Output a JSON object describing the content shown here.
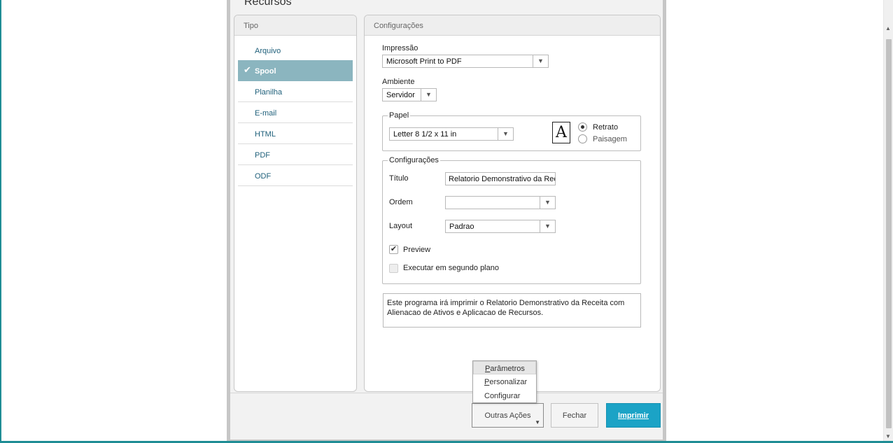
{
  "dialog": {
    "title": "Recursos"
  },
  "tipo": {
    "header": "Tipo",
    "items": [
      {
        "label": "Arquivo",
        "selected": false
      },
      {
        "label": "Spool",
        "selected": true
      },
      {
        "label": "Planilha",
        "selected": false
      },
      {
        "label": "E-mail",
        "selected": false
      },
      {
        "label": "HTML",
        "selected": false
      },
      {
        "label": "PDF",
        "selected": false
      },
      {
        "label": "ODF",
        "selected": false
      }
    ],
    "check_glyph": "✔"
  },
  "config": {
    "header": "Configurações",
    "impressao_label": "Impressão",
    "impressao_value": "Microsoft Print to PDF",
    "ambiente_label": "Ambiente",
    "ambiente_value": "Servidor",
    "papel": {
      "legend": "Papel",
      "size_value": "Letter 8 1/2 x 11 in",
      "icon_letter": "A",
      "orientation_options": [
        "Retrato",
        "Paisagem"
      ],
      "selected_orientation": "Retrato"
    },
    "settings": {
      "legend": "Configurações",
      "titulo_label": "Título",
      "titulo_value": "Relatorio Demonstrativo da Receita",
      "ordem_label": "Ordem",
      "ordem_value": "",
      "layout_label": "Layout",
      "layout_value": "Padrao",
      "preview_label": "Preview",
      "preview_checked": true,
      "background_label": "Executar em segundo plano",
      "background_checked": false
    },
    "description_line1": "Este programa irá imprimir o Relatorio Demonstrativo da Receita com",
    "description_line2": "Alienacao de Ativos e Aplicacao de Recursos."
  },
  "menu": {
    "items": [
      {
        "first": "P",
        "rest": "arâmetros"
      },
      {
        "first": "P",
        "rest": "ersonalizar"
      },
      {
        "first": "",
        "rest": "Configurar"
      }
    ]
  },
  "footer": {
    "outras_label": "Outras Ações",
    "fechar_label": "Fechar",
    "imprimir_label": "Imprimir"
  },
  "glyphs": {
    "dropdown": "▼",
    "scroll_up": "▲",
    "scroll_down": "▼",
    "check": "✔"
  },
  "colors": {
    "accent": "#1ba3c6",
    "selected_row": "#8bb5bf",
    "frame": "#1f8d95"
  }
}
